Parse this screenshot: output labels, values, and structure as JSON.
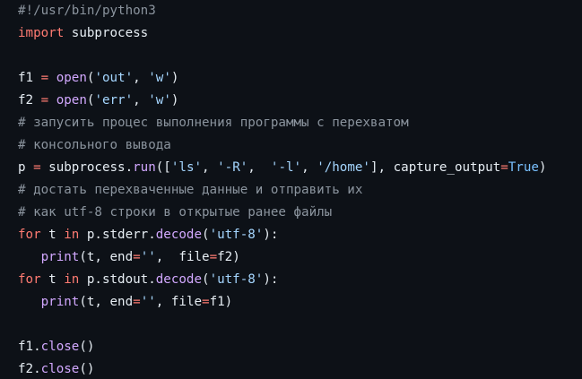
{
  "lines": [
    [
      {
        "t": "#!/usr/bin/python3",
        "c": "comment"
      }
    ],
    [
      {
        "t": "import",
        "c": "keyword"
      },
      {
        "t": " subprocess",
        "c": "plain"
      }
    ],
    [],
    [
      {
        "t": "f1 ",
        "c": "plain"
      },
      {
        "t": "=",
        "c": "keyword"
      },
      {
        "t": " ",
        "c": "plain"
      },
      {
        "t": "open",
        "c": "builtin"
      },
      {
        "t": "(",
        "c": "plain"
      },
      {
        "t": "'out'",
        "c": "string"
      },
      {
        "t": ", ",
        "c": "plain"
      },
      {
        "t": "'w'",
        "c": "string"
      },
      {
        "t": ")",
        "c": "plain"
      }
    ],
    [
      {
        "t": "f2 ",
        "c": "plain"
      },
      {
        "t": "=",
        "c": "keyword"
      },
      {
        "t": " ",
        "c": "plain"
      },
      {
        "t": "open",
        "c": "builtin"
      },
      {
        "t": "(",
        "c": "plain"
      },
      {
        "t": "'err'",
        "c": "string"
      },
      {
        "t": ", ",
        "c": "plain"
      },
      {
        "t": "'w'",
        "c": "string"
      },
      {
        "t": ")",
        "c": "plain"
      }
    ],
    [
      {
        "t": "# запусить процес выполнения программы с перехватом",
        "c": "comment"
      }
    ],
    [
      {
        "t": "# консольного вывода",
        "c": "comment"
      }
    ],
    [
      {
        "t": "p ",
        "c": "plain"
      },
      {
        "t": "=",
        "c": "keyword"
      },
      {
        "t": " subprocess.",
        "c": "plain"
      },
      {
        "t": "run",
        "c": "builtin"
      },
      {
        "t": "([",
        "c": "plain"
      },
      {
        "t": "'ls'",
        "c": "string"
      },
      {
        "t": ", ",
        "c": "plain"
      },
      {
        "t": "'-R'",
        "c": "string"
      },
      {
        "t": ",  ",
        "c": "plain"
      },
      {
        "t": "'-l'",
        "c": "string"
      },
      {
        "t": ", ",
        "c": "plain"
      },
      {
        "t": "'/home'",
        "c": "string"
      },
      {
        "t": "], capture_output",
        "c": "plain"
      },
      {
        "t": "=",
        "c": "keyword"
      },
      {
        "t": "True",
        "c": "constant"
      },
      {
        "t": ")",
        "c": "plain"
      }
    ],
    [
      {
        "t": "# достать перехваченные данные и отправить их",
        "c": "comment"
      }
    ],
    [
      {
        "t": "# как utf-8 строки в открытые ранее файлы",
        "c": "comment"
      }
    ],
    [
      {
        "t": "for",
        "c": "keyword"
      },
      {
        "t": " t ",
        "c": "plain"
      },
      {
        "t": "in",
        "c": "keyword"
      },
      {
        "t": " p.stderr.",
        "c": "plain"
      },
      {
        "t": "decode",
        "c": "builtin"
      },
      {
        "t": "(",
        "c": "plain"
      },
      {
        "t": "'utf-8'",
        "c": "string"
      },
      {
        "t": "):",
        "c": "plain"
      }
    ],
    [
      {
        "t": "   ",
        "c": "plain"
      },
      {
        "t": "print",
        "c": "builtin"
      },
      {
        "t": "(t, end",
        "c": "plain"
      },
      {
        "t": "=",
        "c": "keyword"
      },
      {
        "t": "''",
        "c": "string"
      },
      {
        "t": ",  file",
        "c": "plain"
      },
      {
        "t": "=",
        "c": "keyword"
      },
      {
        "t": "f2)",
        "c": "plain"
      }
    ],
    [
      {
        "t": "for",
        "c": "keyword"
      },
      {
        "t": " t ",
        "c": "plain"
      },
      {
        "t": "in",
        "c": "keyword"
      },
      {
        "t": " p.stdout.",
        "c": "plain"
      },
      {
        "t": "decode",
        "c": "builtin"
      },
      {
        "t": "(",
        "c": "plain"
      },
      {
        "t": "'utf-8'",
        "c": "string"
      },
      {
        "t": "):",
        "c": "plain"
      }
    ],
    [
      {
        "t": "   ",
        "c": "plain"
      },
      {
        "t": "print",
        "c": "builtin"
      },
      {
        "t": "(t, end",
        "c": "plain"
      },
      {
        "t": "=",
        "c": "keyword"
      },
      {
        "t": "''",
        "c": "string"
      },
      {
        "t": ", file",
        "c": "plain"
      },
      {
        "t": "=",
        "c": "keyword"
      },
      {
        "t": "f1)",
        "c": "plain"
      }
    ],
    [],
    [
      {
        "t": "f1.",
        "c": "plain"
      },
      {
        "t": "close",
        "c": "builtin"
      },
      {
        "t": "()",
        "c": "plain"
      }
    ],
    [
      {
        "t": "f2.",
        "c": "plain"
      },
      {
        "t": "close",
        "c": "builtin"
      },
      {
        "t": "()",
        "c": "plain"
      }
    ]
  ],
  "colors": {
    "background": "#0d1117",
    "comment": "#8b949e",
    "keyword": "#ff7b72",
    "builtin": "#d2a8ff",
    "string": "#a5d6ff",
    "constant": "#79c0ff",
    "plain": "#e6edf3"
  }
}
